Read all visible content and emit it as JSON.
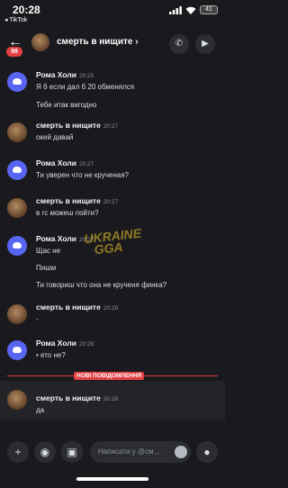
{
  "status": {
    "time": "20:28",
    "back_app": "◂ TikTok",
    "battery": "41"
  },
  "header": {
    "title": "смерть в нищите",
    "badge": "99"
  },
  "messages": [
    {
      "author": "Рома Холи",
      "time": "20:25",
      "lines": [
        "Я б если дал б 20 обменялся",
        "Тебе итак вигодно"
      ]
    },
    {
      "author": "смерть в нищите",
      "time": "20:27",
      "lines": [
        "окей давай"
      ]
    },
    {
      "author": "Рома Холи",
      "time": "20:27",
      "lines": [
        "Ти уверен что не крученая?"
      ]
    },
    {
      "author": "смерть в нищите",
      "time": "20:27",
      "lines": [
        "в гс можеш пойти?"
      ]
    },
    {
      "author": "Рома Холи",
      "time": "20:27",
      "lines": [
        "Щас не",
        "Пишм",
        "Ти говориш что она не крученя финка?"
      ]
    },
    {
      "author": "смерть в нищите",
      "time": "20:28",
      "lines": [
        "-"
      ]
    },
    {
      "author": "Рома Холи",
      "time": "20:28",
      "lines": [
        "• ето не?"
      ]
    },
    {
      "author": "смерть в нищите",
      "time": "20:28",
      "lines": [
        "да"
      ]
    }
  ],
  "divider_label": "НОВІ ПОВІДОМЛЕННЯ",
  "watermark": [
    "UKRAINE",
    "GGA"
  ],
  "composer": {
    "placeholder": "Написати у @см..."
  },
  "colors": {
    "background": "#1a1a1e",
    "blurple": "#5865f2",
    "new_messages_red": "#e23f44"
  }
}
